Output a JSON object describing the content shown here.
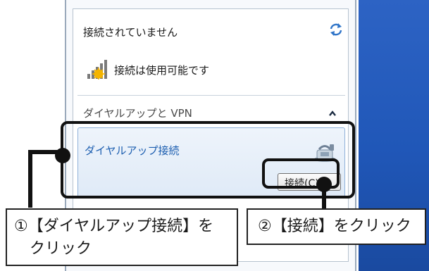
{
  "flyout": {
    "status_text": "接続されていません",
    "available_text": "接続は使用可能です",
    "section_header": "ダイヤルアップと VPN",
    "connection": {
      "name": "ダイヤルアップ接続",
      "button_label": "接続(C)"
    }
  },
  "callouts": {
    "step1_line1": "①【ダイヤルアップ接続】を",
    "step1_line2": "クリック",
    "step2": "②【接続】をクリック"
  },
  "icons": {
    "refresh": "refresh-arrows-icon",
    "signal": "signal-bars-warning-icon",
    "collapse": "chevron-up-icon",
    "phone": "dialup-phone-icon"
  },
  "colors": {
    "desktop_blue": "#2057b8",
    "link_blue": "#1d5fb0",
    "selection_fill": "#dfeaf7",
    "selection_border": "#8fb1d9",
    "annotation_black": "#111111"
  }
}
